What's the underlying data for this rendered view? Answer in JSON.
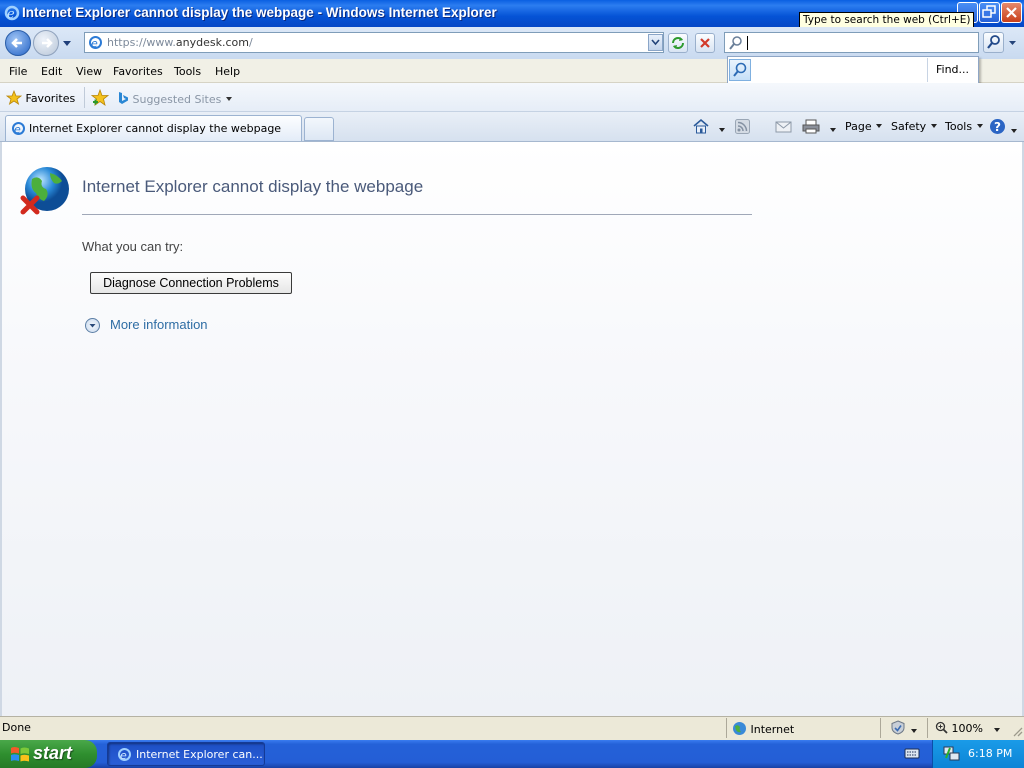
{
  "window": {
    "title": "Internet Explorer cannot display the webpage - Windows Internet Explorer",
    "tooltip": "Type to search the web (Ctrl+E)"
  },
  "address_bar": {
    "prefix": "https://www.",
    "domain": "anydesk.com",
    "suffix": "/"
  },
  "search": {
    "value": "",
    "dropdown_find": "Find..."
  },
  "menu": [
    "File",
    "Edit",
    "View",
    "Favorites",
    "Tools",
    "Help"
  ],
  "favorites_bar": {
    "favorites_label": "Favorites",
    "suggested_label": "Suggested Sites"
  },
  "tab": {
    "title": "Internet Explorer cannot display the webpage"
  },
  "command_bar": {
    "page": "Page",
    "safety": "Safety",
    "tools": "Tools"
  },
  "content": {
    "heading": "Internet Explorer cannot display the webpage",
    "try_text": "What you can try:",
    "diagnose_button": "Diagnose Connection Problems",
    "more_info": "More information"
  },
  "status_bar": {
    "status": "Done",
    "zone": "Internet",
    "zoom": "100%"
  },
  "taskbar": {
    "start": "start",
    "task_label": "Internet Explorer can...",
    "clock": "6:18 PM"
  },
  "colors": {
    "title_bar": "#0553d6",
    "link": "#2e6da4",
    "taskbar": "#245ed6",
    "start_green": "#2f8f2f"
  }
}
